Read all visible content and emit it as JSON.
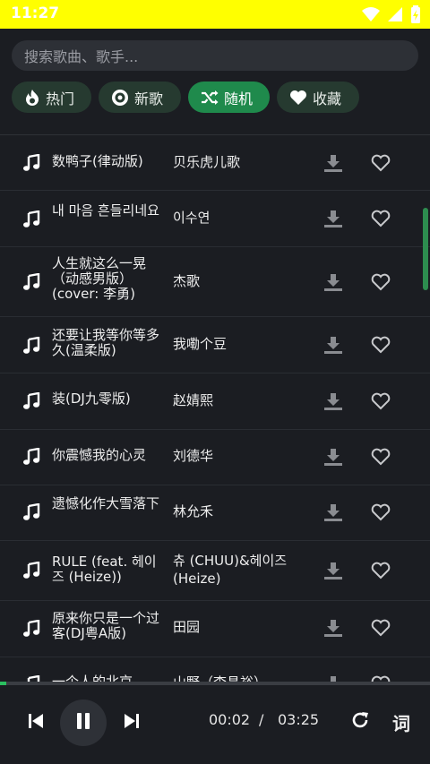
{
  "status": {
    "time": "11:27"
  },
  "search": {
    "placeholder": "搜索歌曲、歌手..."
  },
  "chips": [
    {
      "label": "热门",
      "icon": "flame-icon",
      "active": false
    },
    {
      "label": "新歌",
      "icon": "disc-icon",
      "active": false
    },
    {
      "label": "随机",
      "icon": "shuffle-icon",
      "active": true
    },
    {
      "label": "收藏",
      "icon": "heart-icon",
      "active": false
    }
  ],
  "songs": [
    {
      "title": "数鸭子(律动版)",
      "artist": "贝乐虎儿歌"
    },
    {
      "title": "내 마음 흔들리네요",
      "artist": "이수연"
    },
    {
      "title": "人生就这么一晃（动感男版）(cover: 李勇)",
      "artist": "杰歌"
    },
    {
      "title": "还要让我等你等多久(温柔版)",
      "artist": "我嘞个豆"
    },
    {
      "title": "装(DJ九零版)",
      "artist": "赵婧熙"
    },
    {
      "title": "你震憾我的心灵",
      "artist": "刘德华"
    },
    {
      "title": "遗憾化作大雪落下",
      "artist": "林允禾"
    },
    {
      "title": "RULE (feat. 헤이즈 (Heize))",
      "artist": "츄 (CHUU)&헤이즈 (Heize)"
    },
    {
      "title": "原来你只是一个过客(DJ粤A版)",
      "artist": "田园"
    },
    {
      "title": "一个人的北京",
      "artist": "山野（李昌裕）"
    }
  ],
  "player": {
    "current_time": "00:02",
    "separator": "/",
    "total_time": "03:25",
    "lyrics_label": "词",
    "progress": 0.01
  },
  "colors": {
    "accent": "#1f8a4c",
    "chip_bg": "#263a30",
    "background": "#1b1d22"
  }
}
